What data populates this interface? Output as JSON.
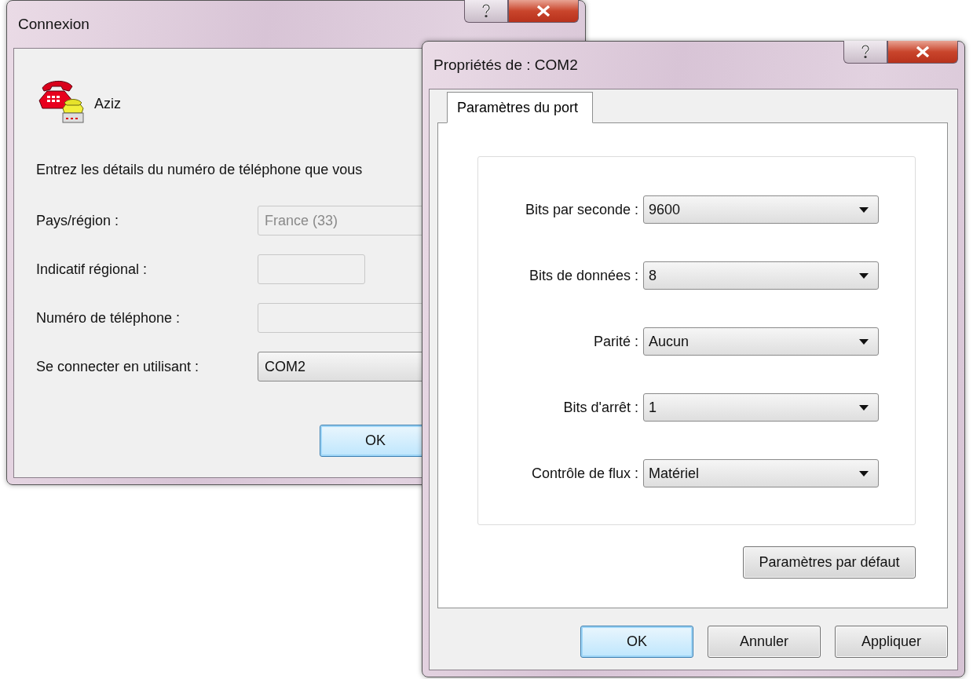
{
  "connection_window": {
    "title": "Connexion",
    "entry_name": "Aziz",
    "instruction": "Entrez les détails du numéro de téléphone que vous",
    "fields": [
      {
        "label": "Pays/région :",
        "kind": "combo",
        "value": "France (33)",
        "disabled": true
      },
      {
        "label": "Indicatif régional :",
        "kind": "short",
        "disabled": true
      },
      {
        "label": "Numéro de téléphone :",
        "kind": "text",
        "disabled": true
      },
      {
        "label": "Se connecter en utilisant :",
        "kind": "combo",
        "value": "COM2",
        "disabled": false
      }
    ],
    "buttons": [
      {
        "label": "OK",
        "default": true
      }
    ]
  },
  "properties_window": {
    "title": "Propriétés de : COM2",
    "tabs": [
      {
        "label": "Paramètres du port",
        "selected": true
      }
    ],
    "settings": [
      {
        "label": "Bits par seconde :",
        "value": "9600"
      },
      {
        "label": "Bits de données :",
        "value": "8"
      },
      {
        "label": "Parité :",
        "value": "Aucun"
      },
      {
        "label": "Bits d'arrêt :",
        "value": "1"
      },
      {
        "label": "Contrôle de flux :",
        "value": "Matériel"
      }
    ],
    "restore_button": "Paramètres par défaut",
    "buttons": [
      {
        "label": "OK",
        "default": true
      },
      {
        "label": "Annuler",
        "default": false
      },
      {
        "label": "Appliquer",
        "default": false
      }
    ]
  }
}
